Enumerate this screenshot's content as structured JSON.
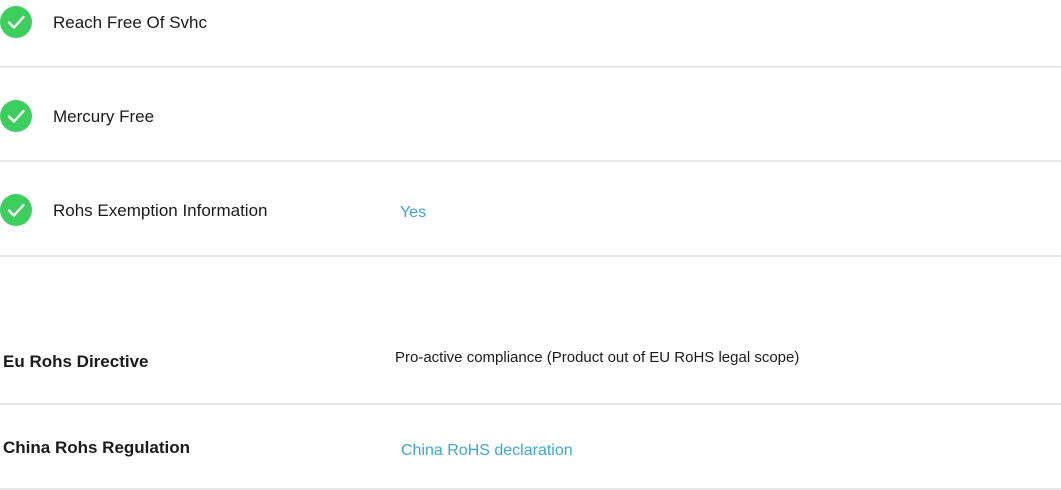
{
  "colors": {
    "check": "#3ccf5e",
    "link": "#3aa6d8",
    "divider": "#e8e8e8"
  },
  "attributes": [
    {
      "icon": "check-circle-icon",
      "label": "Reach Free Of Svhc",
      "value": ""
    },
    {
      "icon": "check-circle-icon",
      "label": "Mercury Free",
      "value": ""
    },
    {
      "icon": "check-circle-icon",
      "label": "Rohs Exemption Information",
      "value": "Yes"
    }
  ],
  "regulations": [
    {
      "label": "Eu Rohs Directive",
      "value": "Pro-active compliance (Product out of EU RoHS legal scope)"
    },
    {
      "label": "China Rohs Regulation",
      "value": "China RoHS declaration"
    }
  ]
}
